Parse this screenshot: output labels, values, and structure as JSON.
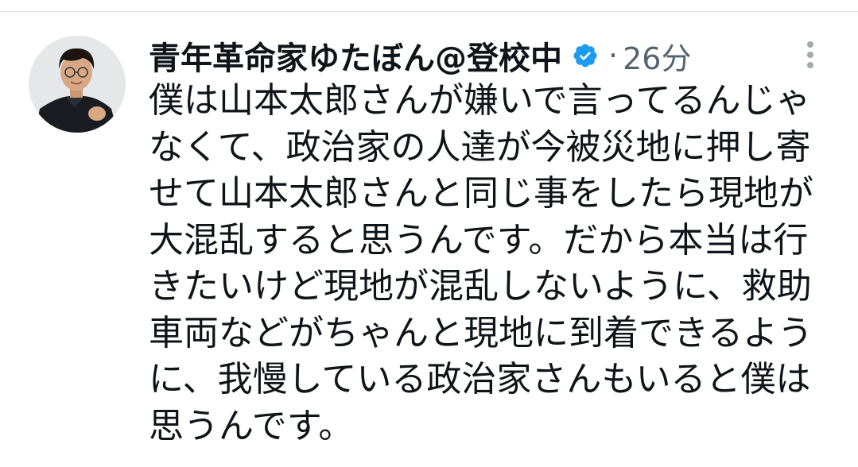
{
  "tweet": {
    "display_name": "青年革命家ゆたぼん@登校中",
    "separator": "·",
    "time": "26分",
    "body_lines": [
      "僕は山本太郎さんが嫌いで言ってるんじゃ",
      "なくて、政治家の人達が今被災地に押し寄",
      "せて山本太郎さんと同じ事をしたら現地が",
      "大混乱すると思うんです。だから本当は行",
      "きたいけど現地が混乱しないように、救助",
      "車両などがちゃんと現地に到着できるよう",
      "に、我慢している政治家さんもいると僕は",
      "思うんです。"
    ]
  },
  "icons": {
    "verified": "verified-badge-icon",
    "more": "more-vertical-icon"
  },
  "colors": {
    "verified_blue": "#1d9bf0",
    "secondary_text": "#536471",
    "primary_text": "#0f1419"
  }
}
